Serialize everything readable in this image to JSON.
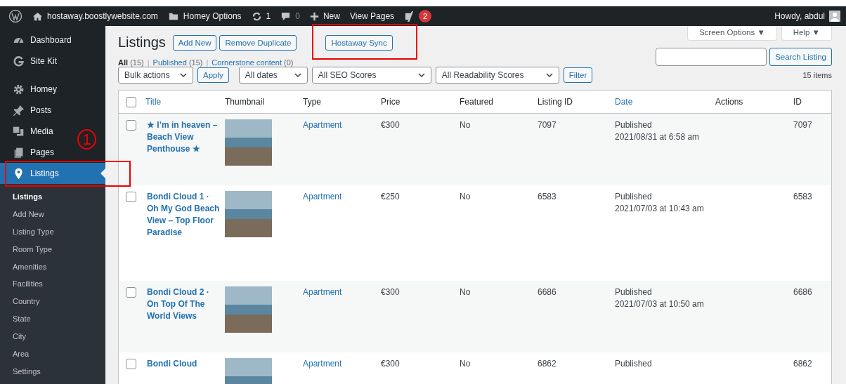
{
  "admin_bar": {
    "site": "hostaway.boostlywebsite.com",
    "options": "Homey Options",
    "updates": "1",
    "comments": "0",
    "new": "New",
    "view": "View Pages",
    "seo_badge": "2",
    "greeting": "Howdy, abdul"
  },
  "sidebar": {
    "items": [
      {
        "label": "Dashboard",
        "kind": "dashboard",
        "selected": false
      },
      {
        "label": "Site Kit",
        "kind": "sitekit",
        "selected": false
      },
      {
        "label": "Homey",
        "kind": "gear",
        "selected": false
      },
      {
        "label": "Posts",
        "kind": "pin",
        "selected": false
      },
      {
        "label": "Media",
        "kind": "media",
        "selected": false
      },
      {
        "label": "Pages",
        "kind": "pages",
        "selected": false
      },
      {
        "label": "Listings",
        "kind": "marker",
        "selected": true
      }
    ],
    "submenu": [
      {
        "label": "Listings",
        "selected": true
      },
      {
        "label": "Add New",
        "selected": false
      },
      {
        "label": "Listing Type",
        "selected": false
      },
      {
        "label": "Room Type",
        "selected": false
      },
      {
        "label": "Amenities",
        "selected": false
      },
      {
        "label": "Facilities",
        "selected": false
      },
      {
        "label": "Country",
        "selected": false
      },
      {
        "label": "State",
        "selected": false
      },
      {
        "label": "City",
        "selected": false
      },
      {
        "label": "Area",
        "selected": false
      },
      {
        "label": "Settings",
        "selected": false
      }
    ]
  },
  "annotation": {
    "step": "1"
  },
  "screen_options": "Screen Options ▼",
  "help": "Help ▼",
  "page_title": "Listings",
  "header_buttons": [
    "Add New",
    "Remove Duplicate",
    "Hostaway Sync"
  ],
  "views": [
    {
      "label": "All",
      "count": "(15)",
      "selected": true
    },
    {
      "label": "Published",
      "count": "(15)",
      "selected": false
    },
    {
      "label": "Cornerstone content",
      "count": "(0)",
      "selected": false
    }
  ],
  "view_separator": "|",
  "search_button": "Search Listing",
  "filters": {
    "bulk": "Bulk actions",
    "apply": "Apply",
    "dates": "All dates",
    "seo": "All SEO Scores",
    "readability": "All Readability Scores",
    "filter": "Filter",
    "count": "15 items"
  },
  "table": {
    "select_all_checked": false,
    "columns": [
      {
        "label": "Title",
        "sortable": true
      },
      {
        "label": "Thumbnail",
        "sortable": false
      },
      {
        "label": "Type",
        "sortable": false
      },
      {
        "label": "Price",
        "sortable": false
      },
      {
        "label": "Featured",
        "sortable": false
      },
      {
        "label": "Listing ID",
        "sortable": false
      },
      {
        "label": "Date",
        "sortable": true
      },
      {
        "label": "Actions",
        "sortable": false
      },
      {
        "label": "ID",
        "sortable": false
      }
    ],
    "rows": [
      {
        "title": "★ I’m in heaven – Beach View Penthouse ★",
        "type": "Apartment",
        "price": "€300",
        "featured": "No",
        "listing_id": "7097",
        "status": "Published",
        "date": "2021/08/31 at 6:58 am",
        "id": "7097",
        "checked": false
      },
      {
        "title": "Bondi Cloud 1 · Oh My God Beach View – Top Floor Paradise",
        "type": "Apartment",
        "price": "€250",
        "featured": "No",
        "listing_id": "6583",
        "status": "Published",
        "date": "2021/07/03 at 10:43 am",
        "id": "6583",
        "checked": false
      },
      {
        "title": "Bondi Cloud 2 · On Top Of The World Views",
        "type": "Apartment",
        "price": "€300",
        "featured": "No",
        "listing_id": "6686",
        "status": "Published",
        "date": "2021/07/03 at 10:50 am",
        "id": "6686",
        "checked": false
      },
      {
        "title": "Bondi Cloud",
        "type": "Apartment",
        "price": "€300",
        "featured": "No",
        "listing_id": "6862",
        "status": "Published",
        "id": "6862",
        "checked": false
      }
    ]
  }
}
